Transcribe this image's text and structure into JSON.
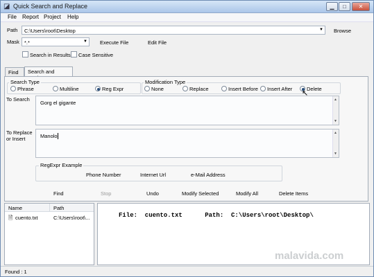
{
  "window": {
    "title": "Quick Search and Replace"
  },
  "menu": [
    "File",
    "Report",
    "Project",
    "Help"
  ],
  "path": {
    "label": "Path",
    "value": "C:\\Users\\root\\Desktop",
    "browse_label": "Browse"
  },
  "mask": {
    "label": "Mask",
    "value": "*.*",
    "execute_label": "Execute File",
    "edit_label": "Edit File"
  },
  "options": {
    "search_in_results": "Search in Results",
    "case_sensitive": "Case Sensitive"
  },
  "tabs": [
    "Find",
    "Search and Replace"
  ],
  "search_type": {
    "title": "Search Type",
    "options": [
      "Phrase",
      "Multiline",
      "Reg Expr"
    ],
    "selected": "Reg Expr"
  },
  "mod_type": {
    "title": "Modification Type",
    "options": [
      "None",
      "Replace",
      "Insert Before",
      "Insert After",
      "Delete"
    ],
    "selected": "Delete"
  },
  "to_search": {
    "label": "To Search",
    "value": "Gorg el gigante"
  },
  "to_replace": {
    "label": "To Replace or Insert",
    "value": "Manolo"
  },
  "regexpr": {
    "title": "RegExpr Example",
    "items": [
      "Phone Number",
      "Internet Url",
      "e-Mail Address"
    ]
  },
  "commands": {
    "find": "Find",
    "stop": "Stop",
    "undo": "Undo",
    "modify_selected": "Modify Selected",
    "modify_all": "Modify All",
    "delete_items": "Delete Items"
  },
  "results_table": {
    "columns": [
      "Name",
      "Path"
    ],
    "rows": [
      {
        "name": "cuento.txt",
        "path": "C:\\Users\\root\\..."
      }
    ]
  },
  "result_text": "File:  cuento.txt      Path:  C:\\Users\\root\\Desktop\\",
  "status": "Found : 1",
  "watermark": "malavida.com"
}
